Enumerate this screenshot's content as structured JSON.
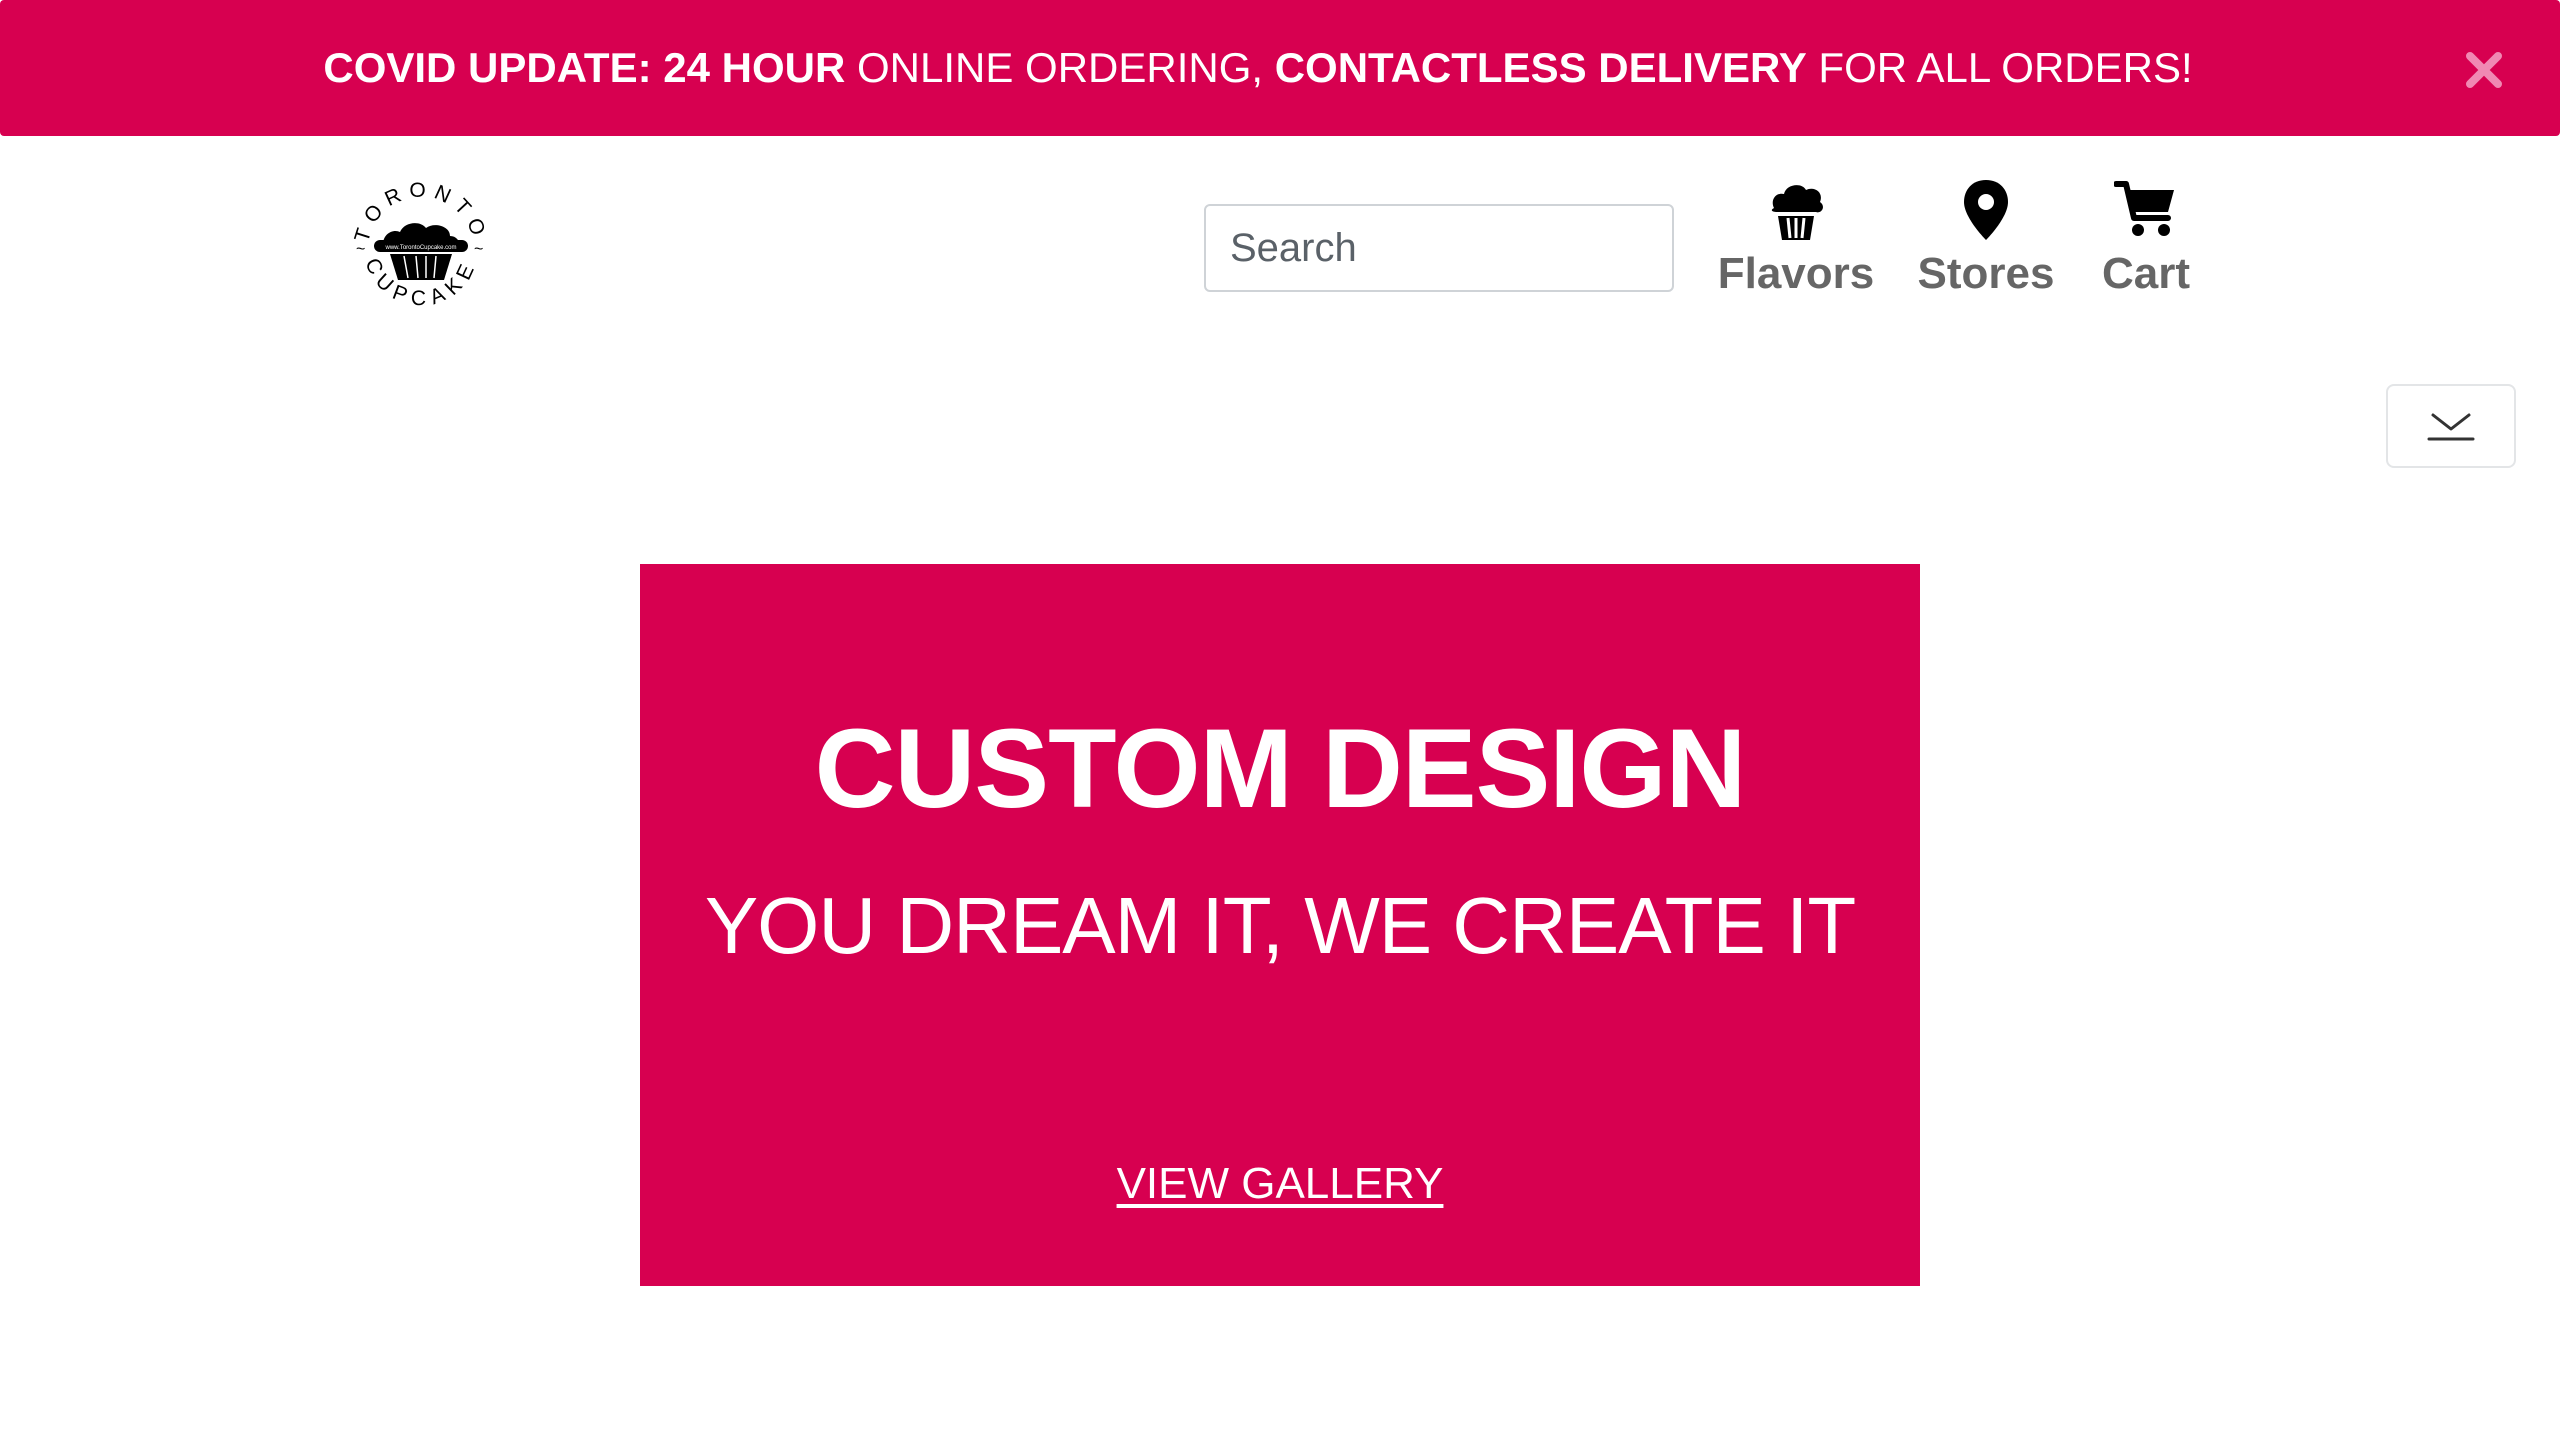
{
  "promo_bar": {
    "part1": "COVID UPDATE: 24 HOUR",
    "part2": " ONLINE ORDERING, ",
    "part3": "CONTACTLESS DELIVERY",
    "part4": " FOR ALL ORDERS!",
    "close_icon": "close-icon",
    "color": "#d70050"
  },
  "header": {
    "logo": {
      "arc_top": "TORONTO",
      "arc_bottom": "CUPCAKE",
      "url_text": "www.TorontoCupcake.com"
    },
    "search": {
      "placeholder": "Search",
      "value": ""
    },
    "nav": {
      "flavors": {
        "label": "Flavors",
        "icon": "cupcake-icon"
      },
      "stores": {
        "label": "Stores",
        "icon": "map-pin-icon"
      },
      "cart": {
        "label": "Cart",
        "icon": "cart-icon"
      }
    },
    "toggle_icon": "chevron-down-icon"
  },
  "hero": {
    "title": "CUSTOM DESIGN",
    "subtitle": "YOU DREAM IT, WE CREATE IT",
    "link": "VIEW GALLERY",
    "color": "#d70050"
  }
}
